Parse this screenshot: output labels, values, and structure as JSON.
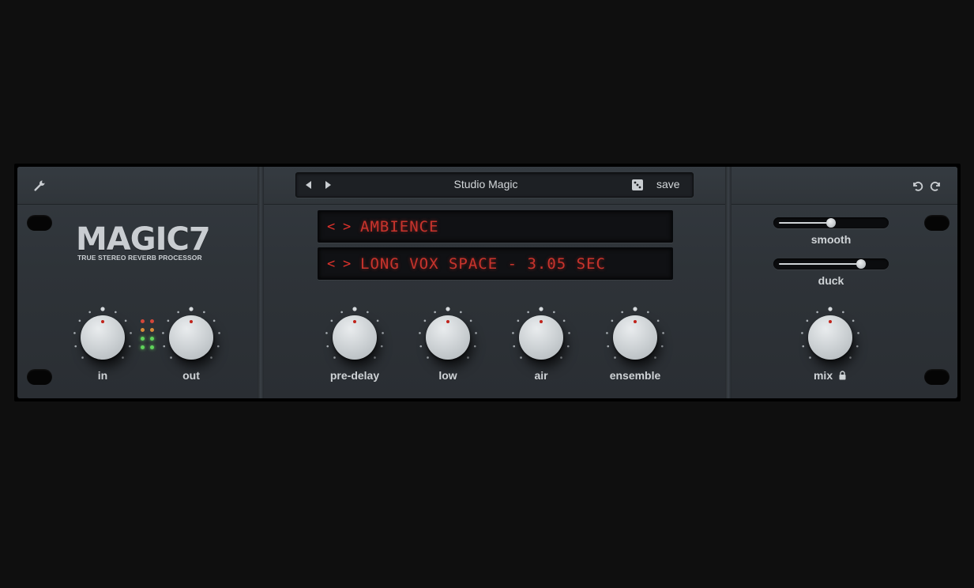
{
  "toolbar": {
    "settings_icon": "wrench-icon",
    "undo_icon": "undo-icon",
    "redo_icon": "redo-icon"
  },
  "preset": {
    "name": "Studio Magic",
    "save_label": "save",
    "prev_icon": "triangle-left-icon",
    "next_icon": "triangle-right-icon",
    "random_icon": "dice-icon"
  },
  "logo": {
    "title": "MAGIC7",
    "subtitle": "TRUE STEREO REVERB PROCESSOR"
  },
  "displays": {
    "category": {
      "prev": "<",
      "next": ">",
      "text": "AMBIENCE"
    },
    "program": {
      "prev": "<",
      "next": ">",
      "text": "LONG VOX SPACE - 3.05 SEC"
    }
  },
  "knobs": {
    "in": {
      "label": "in"
    },
    "out": {
      "label": "out"
    },
    "predelay": {
      "label": "pre-delay"
    },
    "low": {
      "label": "low"
    },
    "air": {
      "label": "air"
    },
    "ensemble": {
      "label": "ensemble"
    },
    "mix": {
      "label": "mix",
      "lock_icon": "lock-icon"
    }
  },
  "sliders": {
    "smooth": {
      "label": "smooth",
      "value": 0.5
    },
    "duck": {
      "label": "duck",
      "value": 0.82
    }
  },
  "colors": {
    "lcd_text": "#c8342d",
    "led_red": "#d4473a",
    "led_orange": "#d88a3a",
    "led_green": "#5fd35a",
    "pointer": "#c0231b"
  }
}
